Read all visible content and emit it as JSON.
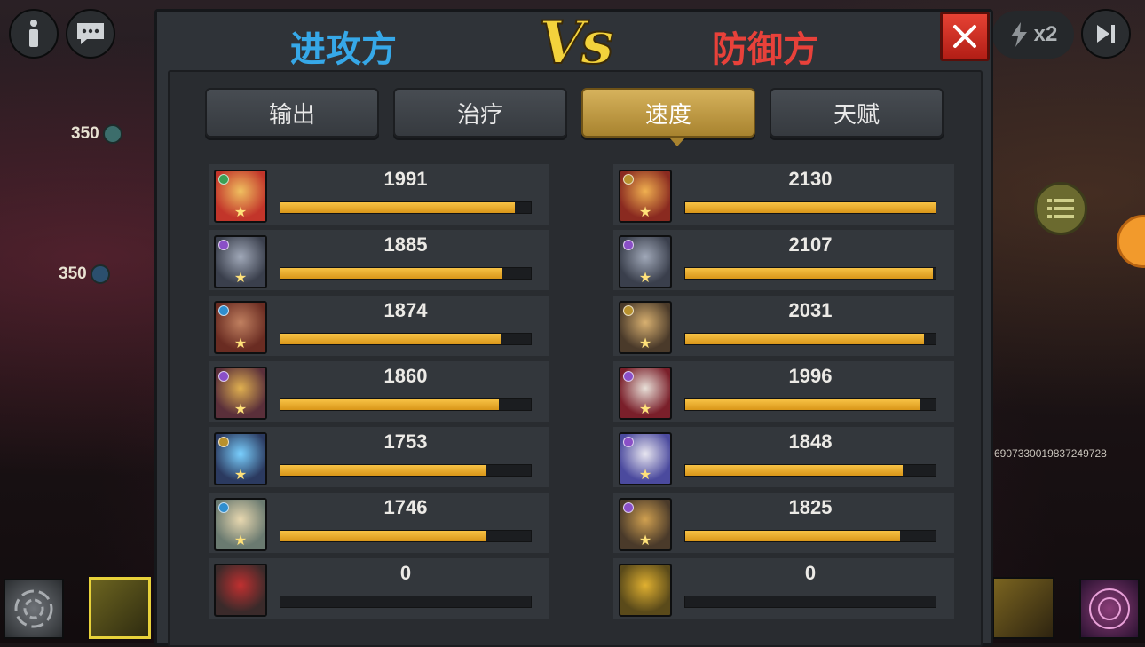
{
  "hud": {
    "hp_values": [
      "350",
      "350"
    ],
    "battle_id": "69073300198372497​28",
    "speed_label": "x2"
  },
  "header": {
    "attacker": "进攻方",
    "vs": "Vs",
    "defender": "防御方"
  },
  "tabs": [
    {
      "label": "输出",
      "active": false
    },
    {
      "label": "治疗",
      "active": false
    },
    {
      "label": "速度",
      "active": true
    },
    {
      "label": "天赋",
      "active": false
    }
  ],
  "max_value": 2130,
  "attackers": [
    {
      "value": "1991",
      "badge_color": "#3aa055",
      "art": [
        "#c2352a",
        "#f0c060"
      ]
    },
    {
      "value": "1885",
      "badge_color": "#8a4fc7",
      "art": [
        "#3a3f4c",
        "#a0a8b8"
      ]
    },
    {
      "value": "1874",
      "badge_color": "#2f8ecf",
      "art": [
        "#6a2c22",
        "#c08060"
      ]
    },
    {
      "value": "1860",
      "badge_color": "#8a4fc7",
      "art": [
        "#5a2f3a",
        "#e0b050"
      ]
    },
    {
      "value": "1753",
      "badge_color": "#b8912e",
      "art": [
        "#2b3a60",
        "#7ad0ff"
      ]
    },
    {
      "value": "1746",
      "badge_color": "#2f8ecf",
      "art": [
        "#6a7a70",
        "#e8d8b0"
      ]
    },
    {
      "value": "0",
      "badge_color": "",
      "art": [
        "#3a2a2a",
        "#c03030"
      ]
    }
  ],
  "defenders": [
    {
      "value": "2130",
      "badge_color": "#b8912e",
      "art": [
        "#8a2a20",
        "#f0b050"
      ]
    },
    {
      "value": "2107",
      "badge_color": "#8a4fc7",
      "art": [
        "#3a3f4c",
        "#a0a8b8"
      ]
    },
    {
      "value": "2031",
      "badge_color": "#b8912e",
      "art": [
        "#4a3a2a",
        "#d8b070"
      ]
    },
    {
      "value": "1996",
      "badge_color": "#8a4fc7",
      "art": [
        "#7a1f2a",
        "#e8e0d8"
      ]
    },
    {
      "value": "1848",
      "badge_color": "#8a4fc7",
      "art": [
        "#4b4a9e",
        "#e8e6f0"
      ]
    },
    {
      "value": "1825",
      "badge_color": "#8a4fc7",
      "art": [
        "#4a3a2a",
        "#d0a050"
      ]
    },
    {
      "value": "0",
      "badge_color": "",
      "art": [
        "#5a4a1a",
        "#e0b030"
      ]
    }
  ],
  "colors": {
    "attacker_title": "#36a8e8",
    "defender_title": "#e8413a",
    "bar_fill": "#f0b431",
    "active_tab": "#c8a24a"
  }
}
